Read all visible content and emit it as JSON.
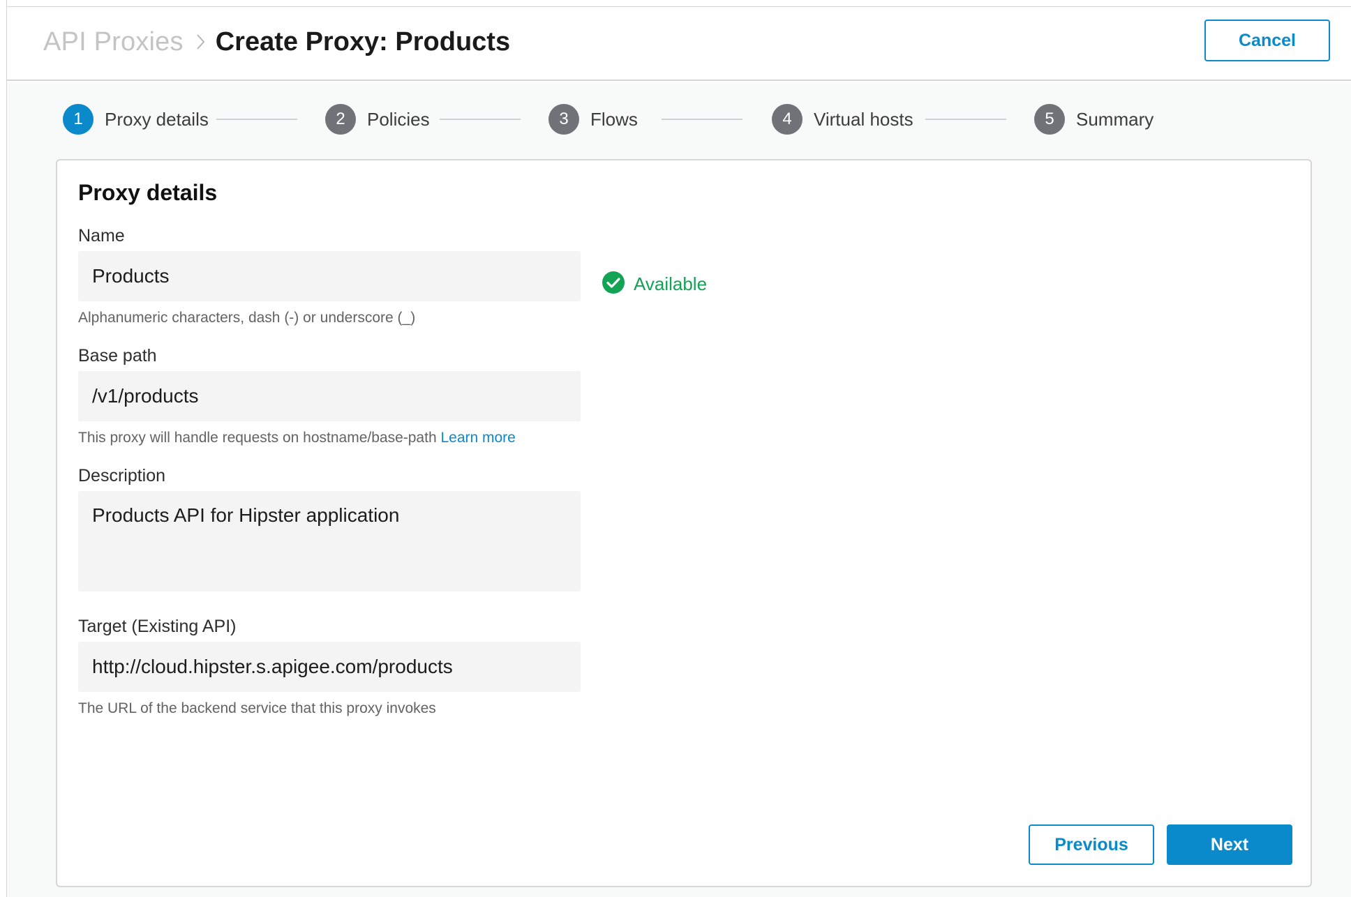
{
  "header": {
    "breadcrumb_parent": "API Proxies",
    "page_title": "Create Proxy: Products",
    "cancel_label": "Cancel"
  },
  "stepper": {
    "steps": [
      {
        "number": "1",
        "label": "Proxy details",
        "active": true
      },
      {
        "number": "2",
        "label": "Policies",
        "active": false
      },
      {
        "number": "3",
        "label": "Flows",
        "active": false
      },
      {
        "number": "4",
        "label": "Virtual hosts",
        "active": false
      },
      {
        "number": "5",
        "label": "Summary",
        "active": false
      }
    ]
  },
  "form": {
    "title": "Proxy details",
    "name": {
      "label": "Name",
      "value": "Products",
      "help": "Alphanumeric characters, dash (-) or underscore (_)",
      "status": "Available"
    },
    "base_path": {
      "label": "Base path",
      "value": "/v1/products",
      "help": "This proxy will handle requests on hostname/base-path",
      "help_link": "Learn more"
    },
    "description": {
      "label": "Description",
      "value": "Products API for Hipster application"
    },
    "target": {
      "label": "Target (Existing API)",
      "value": "http://cloud.hipster.s.apigee.com/products",
      "help": "The URL of the backend service that this proxy invokes"
    },
    "previous_label": "Previous",
    "next_label": "Next"
  },
  "colors": {
    "accent": "#0a8acb",
    "success": "#12a355",
    "step_inactive": "#6f7378"
  }
}
